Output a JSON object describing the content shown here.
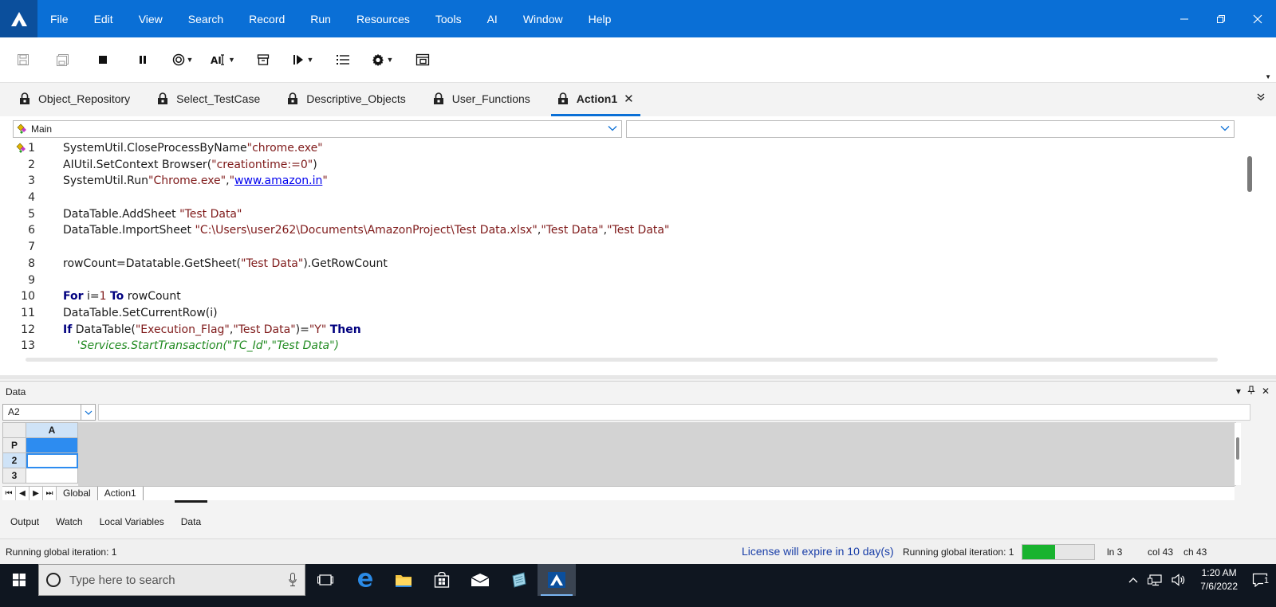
{
  "menu": [
    "File",
    "Edit",
    "View",
    "Search",
    "Record",
    "Run",
    "Resources",
    "Tools",
    "AI",
    "Window",
    "Help"
  ],
  "doc_tabs": [
    {
      "label": "Object_Repository",
      "active": false
    },
    {
      "label": "Select_TestCase",
      "active": false
    },
    {
      "label": "Descriptive_Objects",
      "active": false
    },
    {
      "label": "User_Functions",
      "active": false
    },
    {
      "label": "Action1",
      "active": true
    }
  ],
  "editor": {
    "scope_combo": "Main",
    "member_combo": "",
    "code_lines": [
      {
        "n": "1",
        "tokens": [
          [
            "t",
            "SystemUtil.CloseProcessByName"
          ],
          [
            "s",
            "\"chrome.exe\""
          ]
        ]
      },
      {
        "n": "2",
        "tokens": [
          [
            "t",
            "AIUtil.SetContext Browser("
          ],
          [
            "s",
            "\"creationtime:=0\""
          ],
          [
            "t",
            ")"
          ]
        ]
      },
      {
        "n": "3",
        "tokens": [
          [
            "t",
            "SystemUtil.Run"
          ],
          [
            "s",
            "\"Chrome.exe\""
          ],
          [
            "t",
            ","
          ],
          [
            "s",
            "\""
          ],
          [
            "l",
            "www.amazon.in"
          ],
          [
            "s",
            "\""
          ]
        ]
      },
      {
        "n": "4",
        "tokens": []
      },
      {
        "n": "5",
        "tokens": [
          [
            "t",
            "DataTable.AddSheet "
          ],
          [
            "s",
            "\"Test Data\""
          ]
        ]
      },
      {
        "n": "6",
        "tokens": [
          [
            "t",
            "DataTable.ImportSheet "
          ],
          [
            "s",
            "\"C:\\Users\\user262\\Documents\\AmazonProject\\Test Data.xlsx\""
          ],
          [
            "t",
            ","
          ],
          [
            "s",
            "\"Test Data\""
          ],
          [
            "t",
            ","
          ],
          [
            "s",
            "\"Test Data\""
          ]
        ]
      },
      {
        "n": "7",
        "tokens": []
      },
      {
        "n": "8",
        "tokens": [
          [
            "t",
            "rowCount=Datatable.GetSheet("
          ],
          [
            "s",
            "\"Test Data\""
          ],
          [
            "t",
            ").GetRowCount"
          ]
        ]
      },
      {
        "n": "9",
        "tokens": []
      },
      {
        "n": "10",
        "tokens": [
          [
            "k",
            "For"
          ],
          [
            "t",
            " i="
          ],
          [
            "s",
            "1"
          ],
          [
            "t",
            " "
          ],
          [
            "k",
            "To"
          ],
          [
            "t",
            " rowCount"
          ]
        ]
      },
      {
        "n": "11",
        "tokens": [
          [
            "t",
            "DataTable.SetCurrentRow(i)"
          ]
        ]
      },
      {
        "n": "12",
        "tokens": [
          [
            "k",
            "If"
          ],
          [
            "t",
            " DataTable("
          ],
          [
            "s",
            "\"Execution_Flag\""
          ],
          [
            "t",
            ","
          ],
          [
            "s",
            "\"Test Data\""
          ],
          [
            "t",
            ")="
          ],
          [
            "s",
            "\"Y\""
          ],
          [
            "t",
            " "
          ],
          [
            "k",
            "Then"
          ]
        ]
      },
      {
        "n": "13",
        "tokens": [
          [
            "c",
            "    'Services.StartTransaction(\"TC_Id\",\"Test Data\")"
          ]
        ]
      }
    ]
  },
  "data_pane": {
    "title": "Data",
    "cell_ref": "A2",
    "column_header": "A",
    "row_headers": [
      "P",
      "2",
      "3"
    ],
    "sheet_tabs": [
      "Global",
      "Action1"
    ]
  },
  "panel_tabs": [
    {
      "label": "Output",
      "active": false
    },
    {
      "label": "Watch",
      "active": false
    },
    {
      "label": "Local Variables",
      "active": false
    },
    {
      "label": "Data",
      "active": true
    }
  ],
  "status": {
    "left": "Running global iteration: 1",
    "license": "License will expire in 10 day(s)",
    "iteration": "Running global iteration: 1",
    "progress": 0.45,
    "line": "ln 3",
    "col": "col 43",
    "ch": "ch 43"
  },
  "taskbar": {
    "search_placeholder": "Type here to search",
    "time": "1:20 AM",
    "date": "7/6/2022",
    "notification_count": "1"
  },
  "colors": {
    "accent": "#0a6fd6",
    "keyword": "#00007f",
    "string": "#7f1a1a",
    "comment": "#228b22",
    "progress": "#19b32f",
    "license": "#1a3fa8"
  }
}
